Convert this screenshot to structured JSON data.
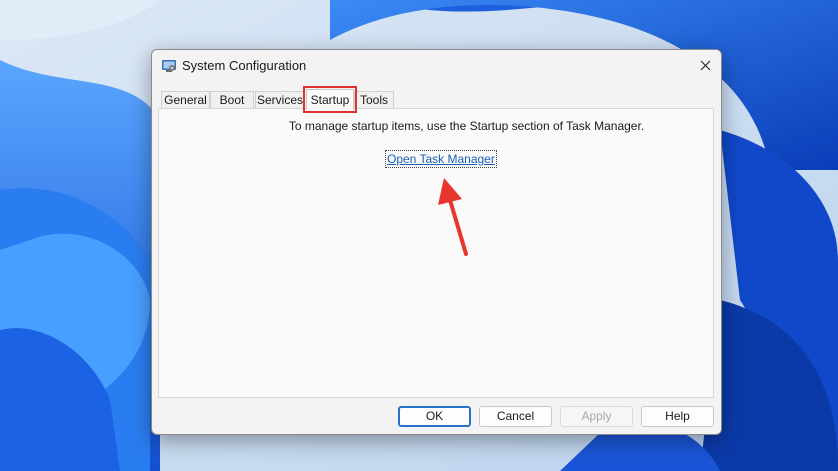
{
  "window": {
    "title": "System Configuration",
    "app_icon": "system-configuration-icon",
    "close_icon": "close-icon"
  },
  "tabs": [
    {
      "label": "General",
      "active": false
    },
    {
      "label": "Boot",
      "active": false
    },
    {
      "label": "Services",
      "active": false
    },
    {
      "label": "Startup",
      "active": true
    },
    {
      "label": "Tools",
      "active": false
    }
  ],
  "startup": {
    "message": "To manage startup items, use the Startup section of Task Manager.",
    "link_text": "Open Task Manager"
  },
  "buttons": {
    "ok": "OK",
    "cancel": "Cancel",
    "apply": "Apply",
    "help": "Help"
  },
  "colors": {
    "highlight": "#e03131",
    "link": "#1a5fb4",
    "wallpaper_blue": "#1553d6"
  }
}
